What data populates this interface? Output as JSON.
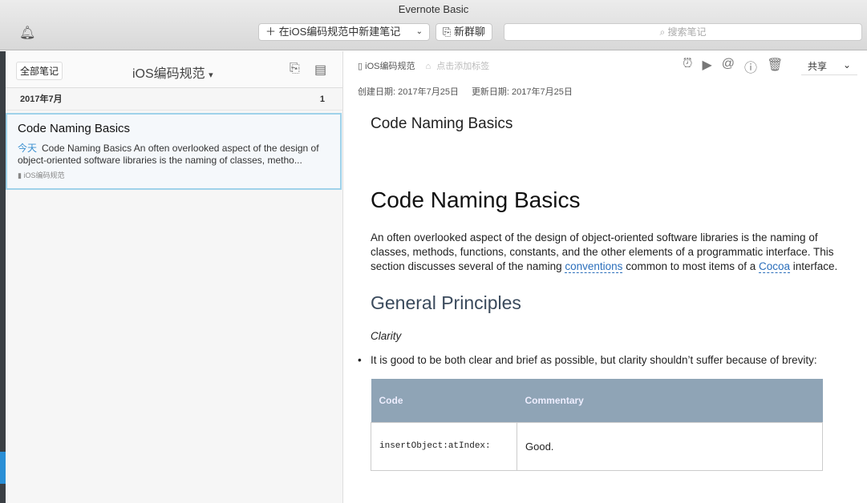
{
  "window": {
    "title": "Evernote Basic"
  },
  "toolbar": {
    "new_note": "在iOS编码规范中新建笔记",
    "new_chat": "新群聊",
    "search_placeholder": "搜索笔记"
  },
  "list": {
    "all_notes": "全部笔记",
    "notebook": "iOS编码规范",
    "group": {
      "label": "2017年7月",
      "count": "1"
    },
    "notes": [
      {
        "title": "Code Naming Basics",
        "date": "今天",
        "snippet": "Code Naming Basics An often overlooked aspect of the design of object-oriented software libraries is the naming of classes, metho...",
        "notebook": "iOS编码规范"
      }
    ]
  },
  "note": {
    "notebook": "iOS编码规范",
    "tag_placeholder": "点击添加标签",
    "share": "共享",
    "created": "创建日期: 2017年7月25日",
    "updated": "更新日期: 2017年7月25日",
    "title": "Code Naming Basics",
    "heading": "Code Naming Basics",
    "para_a": "An often overlooked aspect of the design of object-oriented software libraries is the naming of classes, methods, functions, constants, and the other elements of a programmatic interface. This section discusses several of the naming ",
    "link1": "conventions",
    "para_b": " common to most items of a ",
    "link2": "Cocoa",
    "para_c": " interface.",
    "h2": "General Principles",
    "clarity": "Clarity",
    "bullet": "It is good to be both clear and brief as possible, but clarity shouldn’t suffer because of brevity:",
    "table": {
      "headers": [
        "Code",
        "Commentary"
      ],
      "rows": [
        [
          "insertObject:atIndex:",
          "Good."
        ]
      ]
    }
  }
}
